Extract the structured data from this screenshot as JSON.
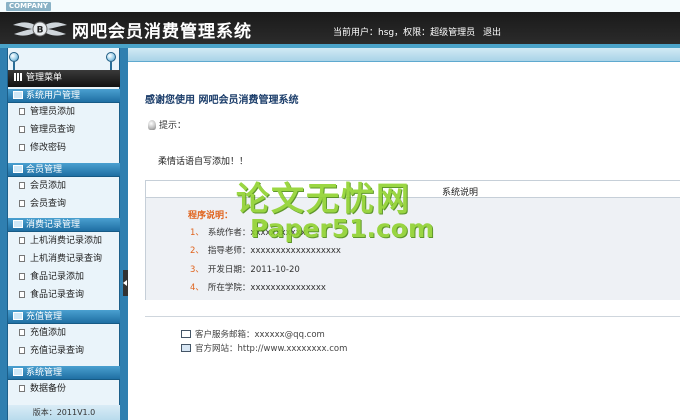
{
  "header": {
    "company_badge": "COMPANY",
    "title": "网吧会员消费管理系统",
    "current_user": "当前用户：hsg，权限：超级管理员",
    "logout": "退出"
  },
  "sidebar": {
    "menu_title": "管理菜单",
    "groups": [
      {
        "title": "系统用户管理",
        "items": [
          "管理员添加",
          "管理员查询",
          "修改密码"
        ]
      },
      {
        "title": "会员管理",
        "items": [
          "会员添加",
          "会员查询"
        ]
      },
      {
        "title": "消费记录管理",
        "items": [
          "上机消费记录添加",
          "上机消费记录查询",
          "食品记录添加",
          "食品记录查询"
        ]
      },
      {
        "title": "充值管理",
        "items": [
          "充值添加",
          "充值记录查询"
        ]
      },
      {
        "title": "系统管理",
        "items": [
          "数据备份"
        ]
      }
    ],
    "version": "版本：2011V1.0"
  },
  "main": {
    "welcome": "感谢您使用 网吧会员消费管理系统",
    "tip_label": "提示：",
    "tip_text": "柔情话语自写添加！！",
    "panel_header": "系统说明",
    "program_label": "程序说明：",
    "lines": [
      {
        "num": "1、",
        "text": "系统作者：xxxxxxxxxxx"
      },
      {
        "num": "2、",
        "text": "指导老师：xxxxxxxxxxxxxxxxxx"
      },
      {
        "num": "3、",
        "text": "开发日期：2011-10-20"
      },
      {
        "num": "4、",
        "text": "所在学院：xxxxxxxxxxxxxxx"
      }
    ]
  },
  "watermark": {
    "cn": "论文无忧网",
    "en": "Paper51.com"
  },
  "footer": {
    "email": "客户服务邮箱：xxxxxx@qq.com",
    "website": "官方网站：http://www.xxxxxxxx.com"
  },
  "colors": {
    "header_dark": "#1a1a1a",
    "sidebar_blue": "#2f7fb0",
    "accent_orange": "#e0641e",
    "watermark_green": "#8ed22a",
    "welcome_navy": "#1b3d6a"
  }
}
